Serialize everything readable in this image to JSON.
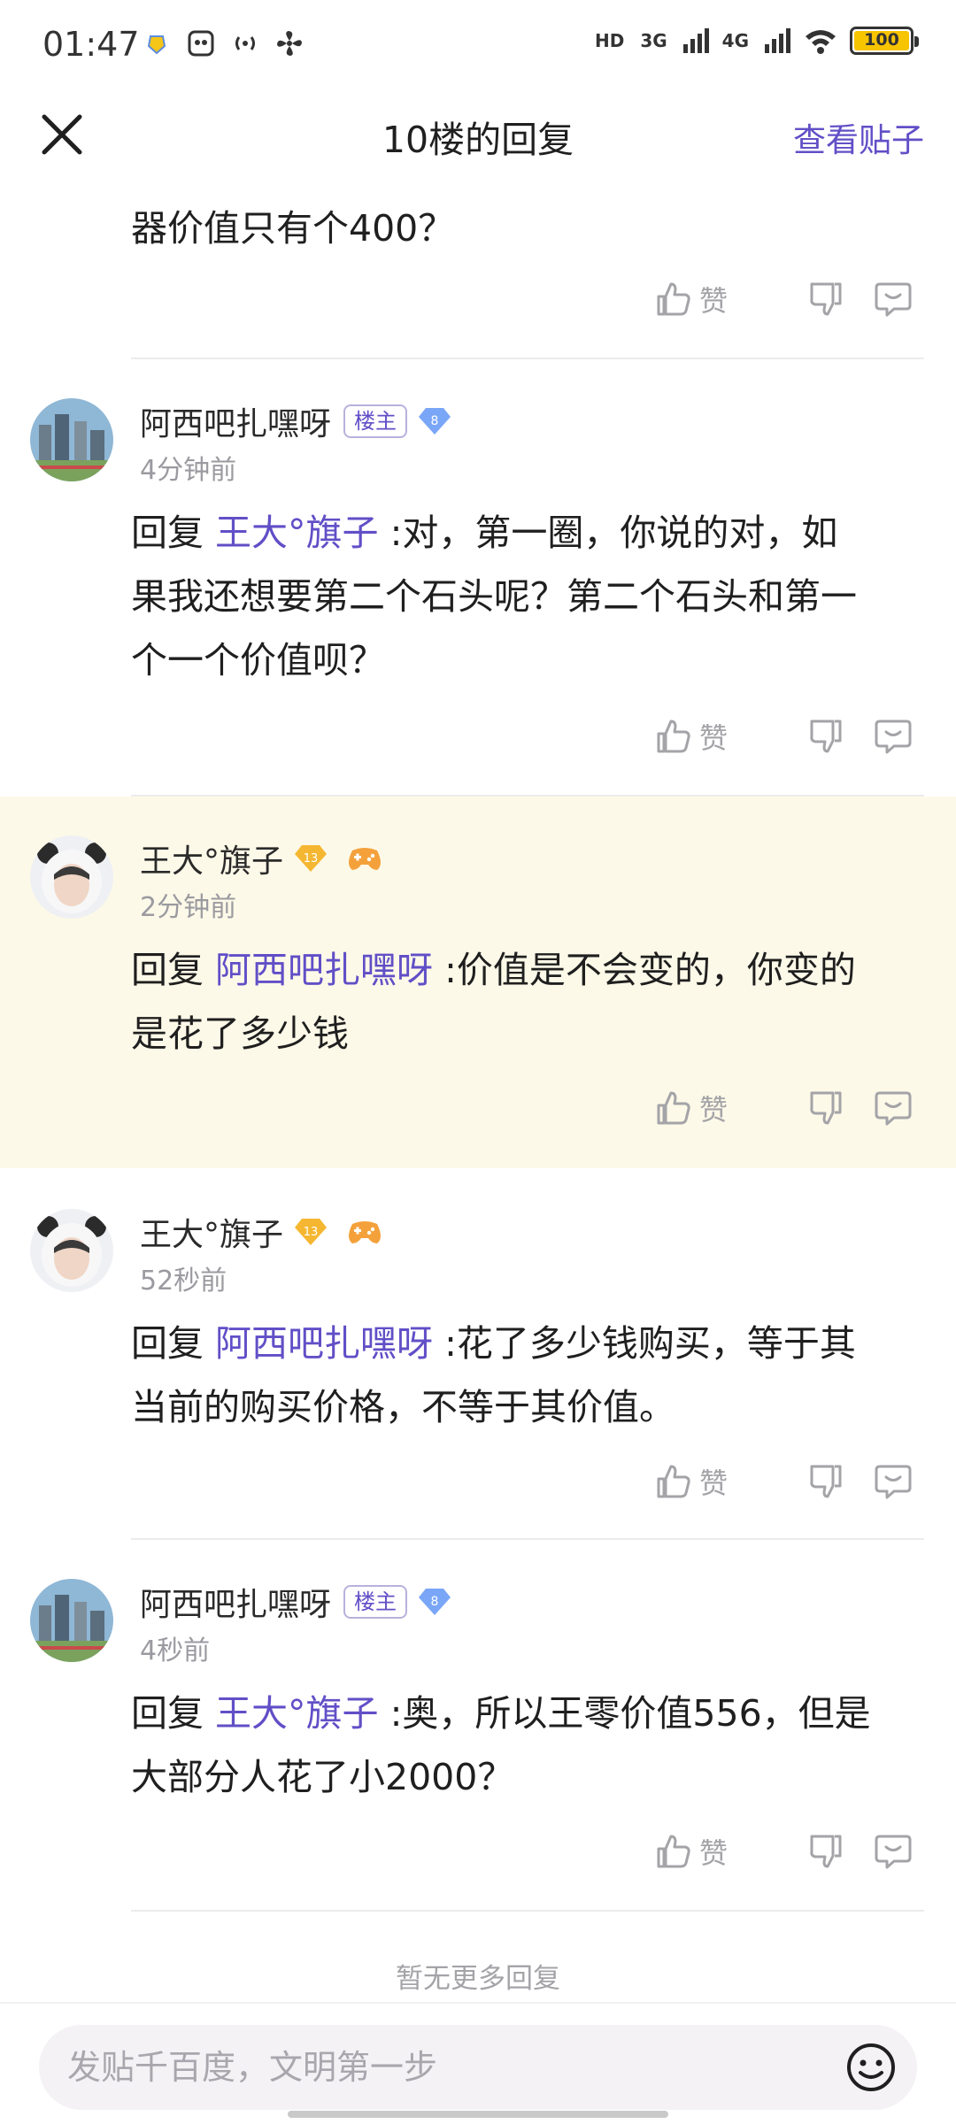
{
  "status_bar": {
    "time": "01:47",
    "network_1": "3G",
    "network_2": "4G",
    "battery": "100",
    "battery_level": 1.0,
    "hd_label": "HD"
  },
  "header": {
    "title": "10楼的回复",
    "view_post": "查看贴子"
  },
  "previous_tail": "器价值只有个400？",
  "action_labels": {
    "like": "赞"
  },
  "replies": [
    {
      "username": "阿西吧扎嘿呀",
      "owner_badge": "楼主",
      "level": "8",
      "time": "4分钟前",
      "reply_prefix": "回复 ",
      "mention": "王大°旗子",
      "text_line_1": " :对，第一圈，你说的对，如",
      "text_line_2": "果我还想要第二个石头呢？第二个石头和第一",
      "text_line_3": "个一个价值呗？",
      "highlight": false
    },
    {
      "username": "王大°旗子",
      "level": "13",
      "time": "2分钟前",
      "reply_prefix": "回复 ",
      "mention": "阿西吧扎嘿呀",
      "text_line_1": " :价值是不会变的，你变的",
      "text_line_2": "是花了多少钱",
      "highlight": true
    },
    {
      "username": "王大°旗子",
      "level": "13",
      "time": "52秒前",
      "reply_prefix": "回复 ",
      "mention": "阿西吧扎嘿呀",
      "text_line_1": " :花了多少钱购买，等于其",
      "text_line_2": "当前的购买价格，不等于其价值。",
      "highlight": false
    },
    {
      "username": "阿西吧扎嘿呀",
      "owner_badge": "楼主",
      "level": "8",
      "time": "4秒前",
      "reply_prefix": "回复 ",
      "mention": "王大°旗子",
      "text_line_1": " :奥，所以王零价值556，但是",
      "text_line_2": "大部分人花了小2000？",
      "highlight": false
    }
  ],
  "footer": {
    "no_more": "暂无更多回复",
    "compose_placeholder": "发贴千百度，文明第一步"
  },
  "colors": {
    "accent": "#614fc7",
    "highlight_bg": "#fdf9e8",
    "muted": "#a4a4a8"
  },
  "icons": [
    "close-icon",
    "thumbs-up-icon",
    "thumbs-down-icon",
    "comment-icon",
    "emoji-icon",
    "diamond-level-icon",
    "game-controller-icon"
  ]
}
